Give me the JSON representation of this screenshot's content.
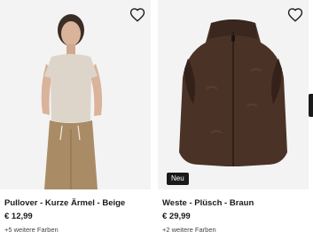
{
  "products": [
    {
      "title": "Pullover - Kurze Ärmel - Beige",
      "price": "€ 12,99",
      "colors_text": "+5 weitere Farben",
      "wishlist_icon": "heart-outline-icon",
      "image_colors": {
        "background": "#f3f3f3",
        "top": "#ddd5ca",
        "trousers": "#a98c66",
        "skin": "#d9b39a",
        "hair": "#3b2d25"
      }
    },
    {
      "title": "Weste - Plüsch - Braun",
      "price": "€ 29,99",
      "colors_text": "+2 weitere Farben",
      "badge": "Neu",
      "wishlist_icon": "heart-outline-icon",
      "image_colors": {
        "background": "#f3f3f3",
        "vest": "#4a3226",
        "vest_shadow": "#34221a"
      }
    }
  ]
}
